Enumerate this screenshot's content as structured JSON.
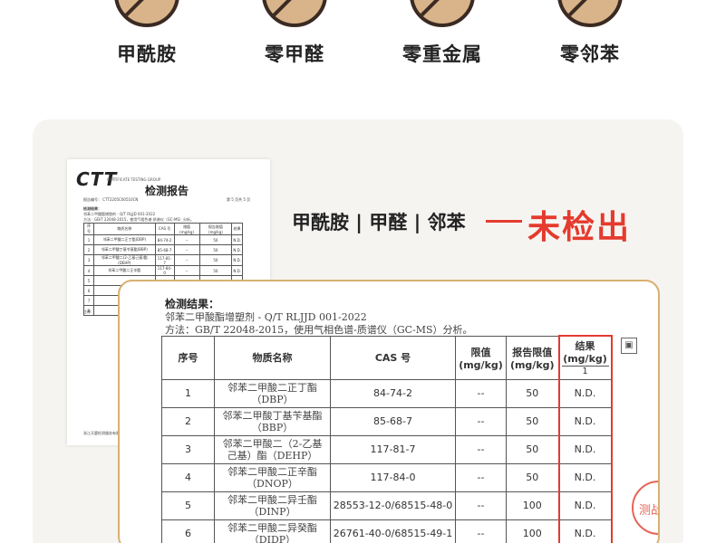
{
  "badges": [
    {
      "label": "甲酰胺",
      "icon": "prohibited-icon"
    },
    {
      "label": "零甲醛",
      "icon": "prohibited-icon"
    },
    {
      "label": "零重金属",
      "icon": "prohibited-icon"
    },
    {
      "label": "零邻苯",
      "icon": "prohibited-icon"
    }
  ],
  "thumbnail": {
    "logo": "CTT",
    "logo_sub": "CERTIFICATE TESTING GROUP",
    "title": "检测报告",
    "report_no": "报告编号： CTT2205C00510CN",
    "page": "第 5 页共 5 页",
    "results_label": "检测结果：",
    "line_standard": "邻苯二甲酸酯增塑剂 - Q/T RLJJD 001-2022",
    "line_method": "方法：GB/T 22048-2015，使用气相色谱-质谱仪（GC-MS）分析。",
    "headers": [
      "序号",
      "物质名称",
      "CAS 号",
      "限值 (mg/kg)",
      "报告限值 (mg/kg)",
      "结果"
    ],
    "rows": [
      [
        "1",
        "邻苯二甲酸二正丁酯(DBP)",
        "84-74-2",
        "--",
        "50",
        "N.D."
      ],
      [
        "2",
        "邻苯二甲酸丁基苄基酯(BBP)",
        "85-68-7",
        "--",
        "50",
        "N.D."
      ],
      [
        "3",
        "邻苯二甲酸二(2-乙基己基)酯(DEHP)",
        "117-81-7",
        "--",
        "50",
        "N.D."
      ],
      [
        "4",
        "邻苯二甲酸二正辛酯",
        "117-84-0",
        "--",
        "50",
        "N.D."
      ],
      [
        "5",
        "",
        "",
        "",
        "",
        ""
      ],
      [
        "6",
        "",
        "",
        "",
        "",
        ""
      ],
      [
        "7",
        "",
        "",
        "",
        "",
        ""
      ],
      [
        "8",
        "",
        "",
        "",
        "",
        ""
      ]
    ],
    "notes_label": "注释：",
    "footer": "浙江天鹿检测服务有限公司"
  },
  "claim": {
    "items": "甲酰胺 | 甲醛 | 邻苯",
    "result": "未检出",
    "accent_color": "#e53a2e"
  },
  "card": {
    "title": "检测结果：",
    "standard": "邻苯二甲酸酯增塑剂 - Q/T RLJJD 001-2022",
    "method": "方法：GB/T 22048-2015，使用气相色谱-质谱仪（GC-MS）分析。",
    "headers": {
      "no": "序号",
      "name": "物质名称",
      "cas": "CAS 号",
      "limit": "限值\n(mg/kg)",
      "report_limit": "报告限值\n(mg/kg)",
      "result": "结果\n(mg/kg)",
      "result_sub": "1"
    },
    "rows": [
      {
        "no": "1",
        "name": "邻苯二甲酸二正丁酯\n（DBP）",
        "cas": "84-74-2",
        "limit": "--",
        "report_limit": "50",
        "result": "N.D."
      },
      {
        "no": "2",
        "name": "邻苯二甲酸丁基苄基酯\n（BBP）",
        "cas": "85-68-7",
        "limit": "--",
        "report_limit": "50",
        "result": "N.D."
      },
      {
        "no": "3",
        "name": "邻苯二甲酸二（2-乙基\n己基）酯（DEHP）",
        "cas": "117-81-7",
        "limit": "--",
        "report_limit": "50",
        "result": "N.D."
      },
      {
        "no": "4",
        "name": "邻苯二甲酸二正辛酯\n（DNOP）",
        "cas": "117-84-0",
        "limit": "--",
        "report_limit": "50",
        "result": "N.D."
      },
      {
        "no": "5",
        "name": "邻苯二甲酸二异壬酯\n（DINP）",
        "cas": "28553-12-0/68515-48-0",
        "limit": "--",
        "report_limit": "100",
        "result": "N.D."
      },
      {
        "no": "6",
        "name": "邻苯二甲酸二异癸酯\n（DIDP）",
        "cas": "26761-40-0/68515-49-1",
        "limit": "--",
        "report_limit": "100",
        "result": "N.D."
      }
    ],
    "stamp_text": "测战",
    "highlight_color": "#e33b2f",
    "border_color": "#d8b070"
  }
}
